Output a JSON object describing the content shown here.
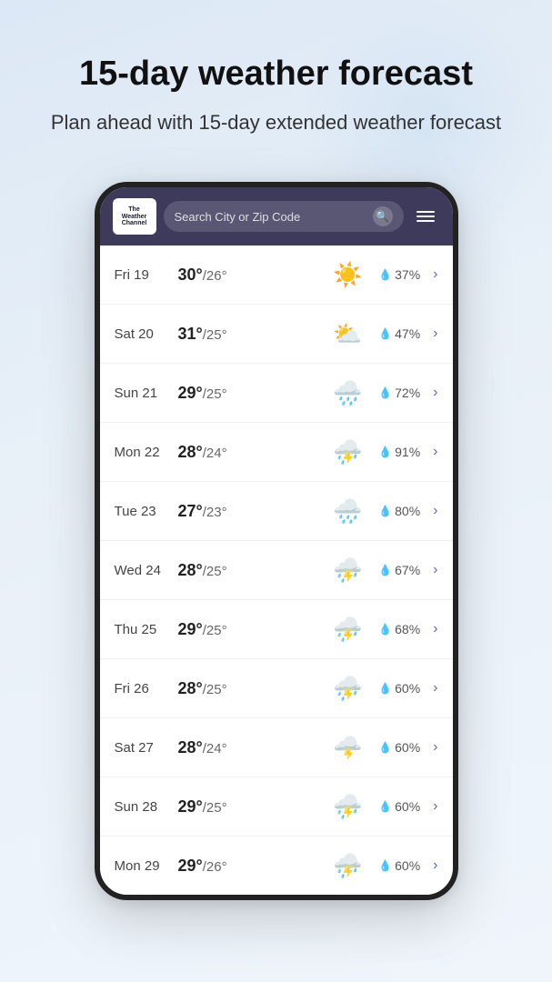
{
  "hero": {
    "title": "15-day weather forecast",
    "subtitle": "Plan ahead with 15-day extended weather forecast"
  },
  "app": {
    "logo_line1": "The",
    "logo_line2": "Weather",
    "logo_line3": "Channel",
    "search_placeholder": "Search City or Zip Code"
  },
  "forecast": [
    {
      "day": "Fri 19",
      "high": "30°",
      "low": "26°",
      "icon": "sunny",
      "precip": "37%",
      "emoji": "☀️"
    },
    {
      "day": "Sat 20",
      "high": "31°",
      "low": "25°",
      "icon": "partly_cloudy_rain",
      "precip": "47%",
      "emoji": "⛅"
    },
    {
      "day": "Sun 21",
      "high": "29°",
      "low": "25°",
      "icon": "cloudy_rain",
      "precip": "72%",
      "emoji": "🌧️"
    },
    {
      "day": "Mon 22",
      "high": "28°",
      "low": "24°",
      "icon": "thunder_rain",
      "precip": "91%",
      "emoji": "⛈️"
    },
    {
      "day": "Tue 23",
      "high": "27°",
      "low": "23°",
      "icon": "cloudy_rain",
      "precip": "80%",
      "emoji": "🌧️"
    },
    {
      "day": "Wed 24",
      "high": "28°",
      "low": "25°",
      "icon": "thunder_rain",
      "precip": "67%",
      "emoji": "⛈️"
    },
    {
      "day": "Thu 25",
      "high": "29°",
      "low": "25°",
      "icon": "thunder_rain",
      "precip": "68%",
      "emoji": "⛈️"
    },
    {
      "day": "Fri 26",
      "high": "28°",
      "low": "25°",
      "icon": "thunder_rain",
      "precip": "60%",
      "emoji": "⛈️"
    },
    {
      "day": "Sat 27",
      "high": "28°",
      "low": "24°",
      "icon": "thunder_heavy",
      "precip": "60%",
      "emoji": "🌩️"
    },
    {
      "day": "Sun 28",
      "high": "29°",
      "low": "25°",
      "icon": "thunder_rain",
      "precip": "60%",
      "emoji": "⛈️"
    },
    {
      "day": "Mon 29",
      "high": "29°",
      "low": "26°",
      "icon": "thunder_rain",
      "precip": "60%",
      "emoji": "⛈️"
    }
  ],
  "colors": {
    "header_bg": "#3d3a5c",
    "chevron": "#5c6bc0",
    "drop": "#6a9fd8",
    "accent": "#3d3a5c"
  },
  "labels": {
    "chevron": "›",
    "drop": "💧",
    "search_icon": "🔍",
    "menu": "≡"
  }
}
